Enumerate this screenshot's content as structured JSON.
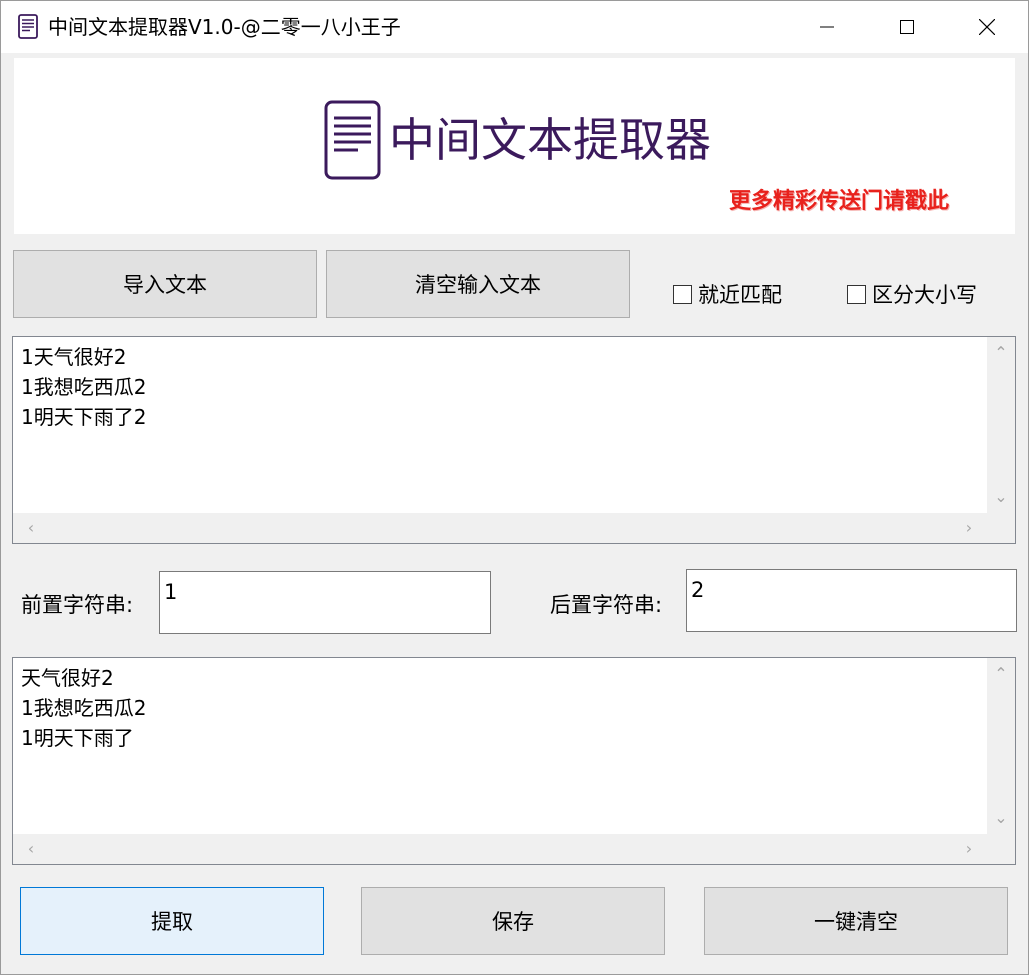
{
  "window": {
    "title": "中间文本提取器V1.0-@二零一八小王子",
    "icons": {
      "app": "document-icon",
      "minimize": "minimize-icon",
      "maximize": "maximize-icon",
      "close": "close-icon"
    }
  },
  "banner": {
    "title": "中间文本提取器",
    "promo_link": "更多精彩传送门请戳此",
    "colors": {
      "title": "#3b1a5c",
      "promo": "#e8211c"
    }
  },
  "toolbar": {
    "import_label": "导入文本",
    "clear_input_label": "清空输入文本",
    "nearest_match_label": "就近匹配",
    "case_sensitive_label": "区分大小写"
  },
  "input_text": {
    "lines": [
      "1天气很好2",
      "1我想吃西瓜2",
      "1明天下雨了2"
    ]
  },
  "delimiters": {
    "prefix_label": "前置字符串:",
    "prefix_value": "1",
    "suffix_label": "后置字符串:",
    "suffix_value": "2"
  },
  "output_text": {
    "lines": [
      "天气很好2",
      "1我想吃西瓜2",
      "1明天下雨了"
    ]
  },
  "actions": {
    "extract_label": "提取",
    "save_label": "保存",
    "clear_all_label": "一键清空"
  },
  "scroll_arrows": {
    "up": "⌃",
    "down": "⌄",
    "left": "‹",
    "right": "›"
  }
}
